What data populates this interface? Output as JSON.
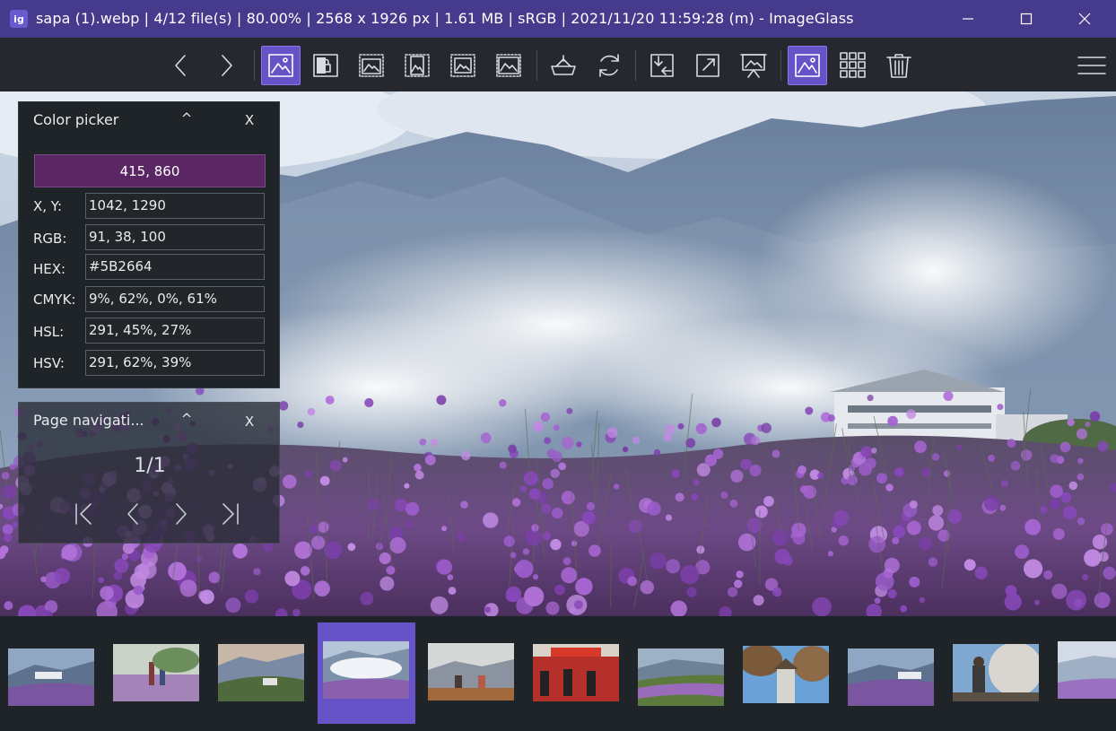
{
  "window": {
    "app_icon_letter": "ig",
    "title": "sapa (1).webp  |  4/12 file(s)  |  80.00%  |  2568 x 1926 px  |  1.61 MB  |  sRGB  |  2021/11/20 11:59:28 (m)  - ImageGlass"
  },
  "toolbar": {
    "buttons": [
      {
        "name": "previous-image",
        "icon": "chevron-left-icon",
        "active": false
      },
      {
        "name": "next-image",
        "icon": "chevron-right-icon",
        "active": false
      },
      {
        "name": "auto-zoom",
        "icon": "image-icon",
        "active": true
      },
      {
        "name": "lock-zoom",
        "icon": "lock-image-icon",
        "active": false
      },
      {
        "name": "scale-to-width",
        "icon": "scale-width-icon",
        "active": false
      },
      {
        "name": "scale-to-height",
        "icon": "scale-height-icon",
        "active": false
      },
      {
        "name": "scale-to-fit",
        "icon": "scale-fit-icon",
        "active": false
      },
      {
        "name": "scale-to-fill",
        "icon": "scale-fill-icon",
        "active": false
      },
      {
        "name": "open-with",
        "icon": "basket-icon",
        "active": false
      },
      {
        "name": "refresh",
        "icon": "refresh-icon",
        "active": false
      },
      {
        "name": "goto-image",
        "icon": "goto-icon",
        "active": false
      },
      {
        "name": "fullscreen",
        "icon": "fullscreen-icon",
        "active": false
      },
      {
        "name": "slideshow",
        "icon": "slideshow-icon",
        "active": false
      },
      {
        "name": "thumbnail-bar",
        "icon": "thumbnail-icon",
        "active": true
      },
      {
        "name": "checkerboard",
        "icon": "grid-icon",
        "active": false
      },
      {
        "name": "delete",
        "icon": "trash-icon",
        "active": false
      },
      {
        "name": "main-menu",
        "icon": "hamburger-icon",
        "active": false
      }
    ]
  },
  "color_picker": {
    "title": "Color picker",
    "collapse": "^",
    "close": "X",
    "swatch_color": "#5B2664",
    "position": "415, 860",
    "rows": [
      {
        "label": "X, Y:",
        "value": "1042, 1290"
      },
      {
        "label": "RGB:",
        "value": "91, 38, 100"
      },
      {
        "label": "HEX:",
        "value": "#5B2664"
      },
      {
        "label": "CMYK:",
        "value": "9%, 62%, 0%, 61%"
      },
      {
        "label": "HSL:",
        "value": "291, 45%, 27%"
      },
      {
        "label": "HSV:",
        "value": "291, 62%, 39%"
      }
    ]
  },
  "page_nav": {
    "title": "Page navigati...",
    "collapse": "^",
    "close": "X",
    "page": "1/1"
  },
  "thumbnails": {
    "count": 11,
    "selected_index": 3
  },
  "colors": {
    "accent": "#6553C7",
    "titlebar": "#453A8C",
    "toolbar": "#25292F"
  }
}
